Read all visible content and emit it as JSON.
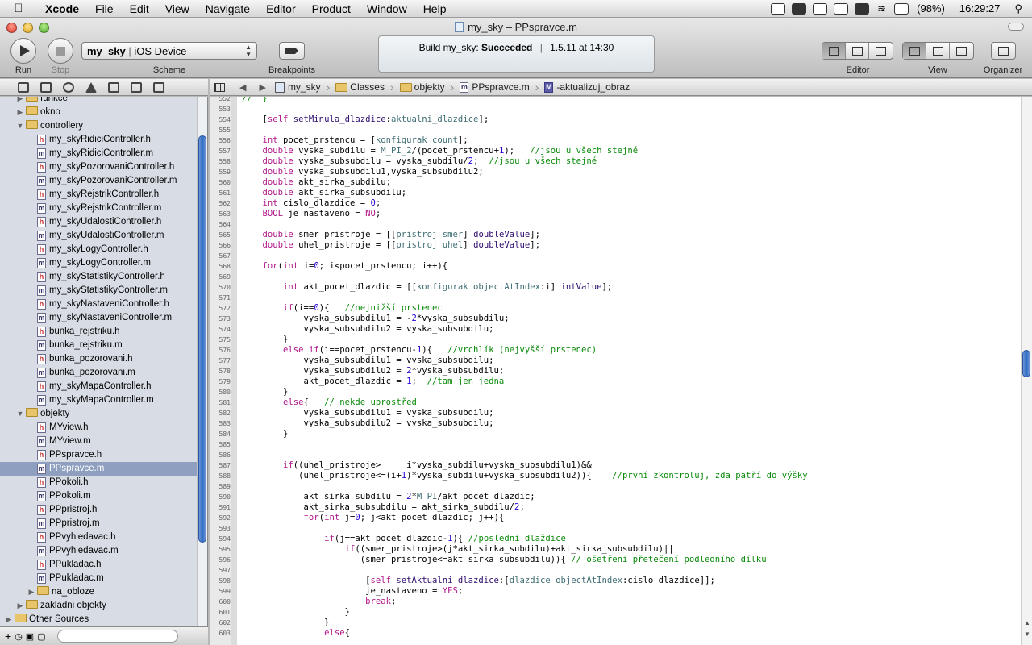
{
  "menubar": {
    "app": "Xcode",
    "items": [
      "File",
      "Edit",
      "View",
      "Navigate",
      "Editor",
      "Product",
      "Window",
      "Help"
    ],
    "battery": "(98%)",
    "clock": "16:29:27"
  },
  "window": {
    "title": "my_sky – PPspravce.m"
  },
  "toolbar": {
    "run_label": "Run",
    "stop_label": "Stop",
    "scheme_target": "my_sky",
    "scheme_device": "iOS Device",
    "scheme_label": "Scheme",
    "breakpoints_label": "Breakpoints",
    "editor_label": "Editor",
    "view_label": "View",
    "organizer_label": "Organizer"
  },
  "status": {
    "prefix": "Build my_sky: ",
    "result": "Succeeded",
    "sep": "|",
    "time": "1.5.11 at 14:30"
  },
  "jumpbar": {
    "project": "my_sky",
    "group1": "Classes",
    "group2": "objekty",
    "file": "PPspravce.m",
    "method_icon": "M",
    "method": "-aktualizuj_obraz"
  },
  "sidebar": {
    "items": [
      {
        "type": "folder",
        "label": "funkce",
        "expanded": false,
        "indent": 1
      },
      {
        "type": "folder",
        "label": "okno",
        "expanded": false,
        "indent": 1
      },
      {
        "type": "folder",
        "label": "controllery",
        "expanded": true,
        "indent": 1
      },
      {
        "type": "h",
        "label": "my_skyRidiciController.h",
        "indent": 2
      },
      {
        "type": "m",
        "label": "my_skyRidiciController.m",
        "indent": 2
      },
      {
        "type": "h",
        "label": "my_skyPozorovaniController.h",
        "indent": 2
      },
      {
        "type": "m",
        "label": "my_skyPozorovaniController.m",
        "indent": 2
      },
      {
        "type": "h",
        "label": "my_skyRejstrikController.h",
        "indent": 2
      },
      {
        "type": "m",
        "label": "my_skyRejstrikController.m",
        "indent": 2
      },
      {
        "type": "h",
        "label": "my_skyUdalostiController.h",
        "indent": 2
      },
      {
        "type": "m",
        "label": "my_skyUdalostiController.m",
        "indent": 2
      },
      {
        "type": "h",
        "label": "my_skyLogyController.h",
        "indent": 2
      },
      {
        "type": "m",
        "label": "my_skyLogyController.m",
        "indent": 2
      },
      {
        "type": "h",
        "label": "my_skyStatistikyController.h",
        "indent": 2
      },
      {
        "type": "m",
        "label": "my_skyStatistikyController.m",
        "indent": 2
      },
      {
        "type": "h",
        "label": "my_skyNastaveniController.h",
        "indent": 2
      },
      {
        "type": "m",
        "label": "my_skyNastaveniController.m",
        "indent": 2
      },
      {
        "type": "h",
        "label": "bunka_rejstriku.h",
        "indent": 2
      },
      {
        "type": "m",
        "label": "bunka_rejstriku.m",
        "indent": 2
      },
      {
        "type": "h",
        "label": "bunka_pozorovani.h",
        "indent": 2
      },
      {
        "type": "m",
        "label": "bunka_pozorovani.m",
        "indent": 2
      },
      {
        "type": "h",
        "label": "my_skyMapaController.h",
        "indent": 2
      },
      {
        "type": "m",
        "label": "my_skyMapaController.m",
        "indent": 2
      },
      {
        "type": "folder",
        "label": "objekty",
        "expanded": true,
        "indent": 1
      },
      {
        "type": "h",
        "label": "MYview.h",
        "indent": 2
      },
      {
        "type": "m",
        "label": "MYview.m",
        "indent": 2
      },
      {
        "type": "h",
        "label": "PPspravce.h",
        "indent": 2
      },
      {
        "type": "m",
        "label": "PPspravce.m",
        "indent": 2,
        "selected": true
      },
      {
        "type": "h",
        "label": "PPokoli.h",
        "indent": 2
      },
      {
        "type": "m",
        "label": "PPokoli.m",
        "indent": 2
      },
      {
        "type": "h",
        "label": "PPpristroj.h",
        "indent": 2
      },
      {
        "type": "m",
        "label": "PPpristroj.m",
        "indent": 2
      },
      {
        "type": "h",
        "label": "PPvyhledavac.h",
        "indent": 2
      },
      {
        "type": "m",
        "label": "PPvyhledavac.m",
        "indent": 2
      },
      {
        "type": "h",
        "label": "PPukladac.h",
        "indent": 2
      },
      {
        "type": "m",
        "label": "PPukladac.m",
        "indent": 2
      },
      {
        "type": "folder",
        "label": "na_obloze",
        "expanded": false,
        "indent": 2
      },
      {
        "type": "folder",
        "label": "zakladni objekty",
        "expanded": false,
        "indent": 1
      },
      {
        "type": "folder",
        "label": "Other Sources",
        "expanded": false,
        "indent": 0
      }
    ]
  },
  "code": {
    "lines": [
      {
        "n": "552",
        "t": "//  }"
      },
      {
        "n": "553",
        "t": ""
      },
      {
        "n": "554",
        "t": "    [self setMinula_dlazdice:aktualni_dlazdice];"
      },
      {
        "n": "555",
        "t": ""
      },
      {
        "n": "556",
        "t": "    int pocet_prstencu = [konfigurak count];"
      },
      {
        "n": "557",
        "t": "    double vyska_subdilu = M_PI_2/(pocet_prstencu+1);   //jsou u všech stejné"
      },
      {
        "n": "558",
        "t": "    double vyska_subsubdilu = vyska_subdilu/2;  //jsou u všech stejné"
      },
      {
        "n": "559",
        "t": "    double vyska_subsubdilu1,vyska_subsubdilu2;"
      },
      {
        "n": "560",
        "t": "    double akt_sirka_subdilu;"
      },
      {
        "n": "561",
        "t": "    double akt_sirka_subsubdilu;"
      },
      {
        "n": "562",
        "t": "    int cislo_dlazdice = 0;"
      },
      {
        "n": "563",
        "t": "    BOOL je_nastaveno = NO;"
      },
      {
        "n": "564",
        "t": ""
      },
      {
        "n": "565",
        "t": "    double smer_pristroje = [[pristroj smer] doubleValue];"
      },
      {
        "n": "566",
        "t": "    double uhel_pristroje = [[pristroj uhel] doubleValue];"
      },
      {
        "n": "567",
        "t": ""
      },
      {
        "n": "568",
        "t": "    for(int i=0; i<pocet_prstencu; i++){"
      },
      {
        "n": "569",
        "t": ""
      },
      {
        "n": "570",
        "t": "        int akt_pocet_dlazdic = [[konfigurak objectAtIndex:i] intValue];"
      },
      {
        "n": "571",
        "t": ""
      },
      {
        "n": "572",
        "t": "        if(i==0){   //nejnižší prstenec"
      },
      {
        "n": "573",
        "t": "            vyska_subsubdilu1 = -2*vyska_subsubdilu;"
      },
      {
        "n": "574",
        "t": "            vyska_subsubdilu2 = vyska_subsubdilu;"
      },
      {
        "n": "575",
        "t": "        }"
      },
      {
        "n": "576",
        "t": "        else if(i==pocet_prstencu-1){   //vrchlík (nejvyšší prstenec)"
      },
      {
        "n": "577",
        "t": "            vyska_subsubdilu1 = vyska_subsubdilu;"
      },
      {
        "n": "578",
        "t": "            vyska_subsubdilu2 = 2*vyska_subsubdilu;"
      },
      {
        "n": "579",
        "t": "            akt_pocet_dlazdic = 1;  //tam jen jedna"
      },
      {
        "n": "580",
        "t": "        }"
      },
      {
        "n": "581",
        "t": "        else{   // nekde uprostřed"
      },
      {
        "n": "582",
        "t": "            vyska_subsubdilu1 = vyska_subsubdilu;"
      },
      {
        "n": "583",
        "t": "            vyska_subsubdilu2 = vyska_subsubdilu;"
      },
      {
        "n": "584",
        "t": "        }"
      },
      {
        "n": "585",
        "t": ""
      },
      {
        "n": "586",
        "t": ""
      },
      {
        "n": "587",
        "t": "        if((uhel_pristroje>     i*vyska_subdilu+vyska_subsubdilu1)&&"
      },
      {
        "n": "588",
        "t": "           (uhel_pristroje<=(i+1)*vyska_subdilu+vyska_subsubdilu2)){    //první zkontroluj, zda patří do výšky"
      },
      {
        "n": "589",
        "t": ""
      },
      {
        "n": "590",
        "t": "            akt_sirka_subdilu = 2*M_PI/akt_pocet_dlazdic;"
      },
      {
        "n": "591",
        "t": "            akt_sirka_subsubdilu = akt_sirka_subdilu/2;"
      },
      {
        "n": "592",
        "t": "            for(int j=0; j<akt_pocet_dlazdic; j++){"
      },
      {
        "n": "593",
        "t": ""
      },
      {
        "n": "594",
        "t": "                if(j==akt_pocet_dlazdic-1){ //poslední dlaždice"
      },
      {
        "n": "595",
        "t": "                    if((smer_pristroje>(j*akt_sirka_subdilu)+akt_sirka_subsubdilu)||"
      },
      {
        "n": "596",
        "t": "                       (smer_pristroje<=akt_sirka_subsubdilu)){ // ošetření přetečení podledního dílku"
      },
      {
        "n": "597",
        "t": ""
      },
      {
        "n": "598",
        "t": "                        [self setAktualni_dlazdice:[dlazdice objectAtIndex:cislo_dlazdice]];"
      },
      {
        "n": "599",
        "t": "                        je_nastaveno = YES;"
      },
      {
        "n": "600",
        "t": "                        break;"
      },
      {
        "n": "601",
        "t": "                    }"
      },
      {
        "n": "602",
        "t": "                }"
      },
      {
        "n": "603",
        "t": "                else{"
      }
    ]
  }
}
